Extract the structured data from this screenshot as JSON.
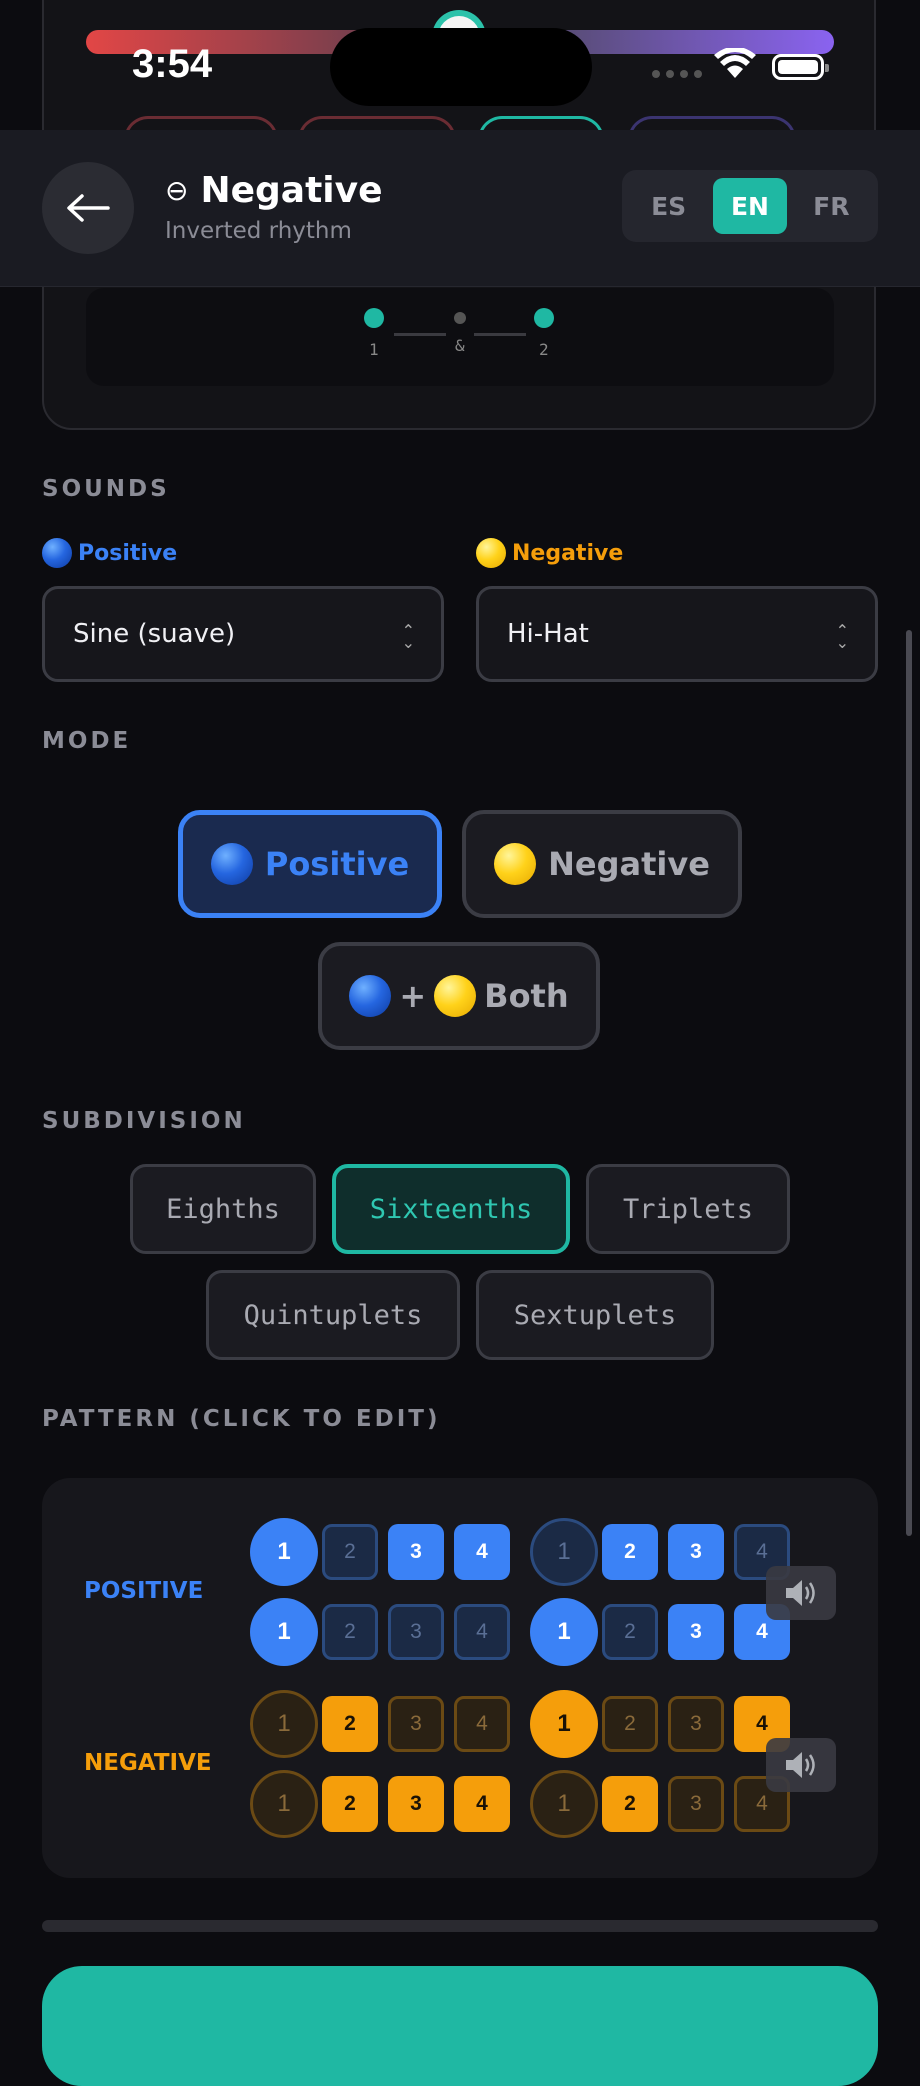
{
  "status_bar": {
    "time": "3:54"
  },
  "header": {
    "title_symbol": "⊖",
    "title": "Negative",
    "subtitle": "Inverted rhythm",
    "languages": [
      "ES",
      "EN",
      "FR"
    ],
    "active_language": "EN"
  },
  "beat_display": {
    "labels": [
      "1",
      "&",
      "2"
    ]
  },
  "sounds": {
    "heading": "SOUNDS",
    "positive_label": "Positive",
    "negative_label": "Negative",
    "positive_value": "Sine (suave)",
    "negative_value": "Hi-Hat"
  },
  "mode": {
    "heading": "MODE",
    "positive": "Positive",
    "negative": "Negative",
    "both_plus": "+",
    "both": "Both",
    "selected": "Positive"
  },
  "subdivision": {
    "heading": "SUBDIVISION",
    "options": [
      "Eighths",
      "Sixteenths",
      "Triplets",
      "Quintuplets",
      "Sextuplets"
    ],
    "selected": "Sixteenths"
  },
  "pattern": {
    "heading": "PATTERN (CLICK TO EDIT)",
    "positive_label": "POSITIVE",
    "negative_label": "NEGATIVE",
    "positive_rows": [
      [
        {
          "n": "1",
          "on": true
        },
        {
          "n": "2",
          "on": false
        },
        {
          "n": "3",
          "on": true
        },
        {
          "n": "4",
          "on": true
        },
        {
          "n": "1",
          "on": false
        },
        {
          "n": "2",
          "on": true
        },
        {
          "n": "3",
          "on": true
        },
        {
          "n": "4",
          "on": false
        }
      ],
      [
        {
          "n": "1",
          "on": true
        },
        {
          "n": "2",
          "on": false
        },
        {
          "n": "3",
          "on": false
        },
        {
          "n": "4",
          "on": false
        },
        {
          "n": "1",
          "on": true
        },
        {
          "n": "2",
          "on": false
        },
        {
          "n": "3",
          "on": true
        },
        {
          "n": "4",
          "on": true
        }
      ]
    ],
    "negative_rows": [
      [
        {
          "n": "1",
          "on": false
        },
        {
          "n": "2",
          "on": true
        },
        {
          "n": "3",
          "on": false
        },
        {
          "n": "4",
          "on": false
        },
        {
          "n": "1",
          "on": true
        },
        {
          "n": "2",
          "on": false
        },
        {
          "n": "3",
          "on": false
        },
        {
          "n": "4",
          "on": true
        }
      ],
      [
        {
          "n": "1",
          "on": false
        },
        {
          "n": "2",
          "on": true
        },
        {
          "n": "3",
          "on": true
        },
        {
          "n": "4",
          "on": true
        },
        {
          "n": "1",
          "on": false
        },
        {
          "n": "2",
          "on": true
        },
        {
          "n": "3",
          "on": false
        },
        {
          "n": "4",
          "on": false
        }
      ]
    ]
  },
  "colors": {
    "accent": "#1fb8a3",
    "positive": "#3b82f6",
    "negative": "#f59e0b"
  }
}
